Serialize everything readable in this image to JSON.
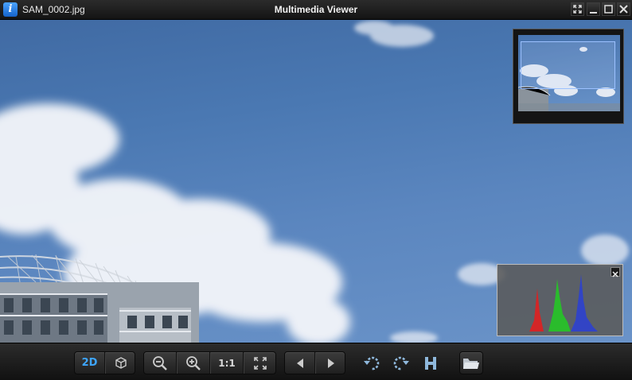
{
  "titlebar": {
    "file_name": "SAM_0002.jpg",
    "app_title": "Multimedia Viewer",
    "app_icon": "info-icon",
    "buttons": [
      "fullscreen-icon",
      "minimize-icon",
      "maximize-icon",
      "close-icon"
    ]
  },
  "viewport": {
    "image": "sky-clouds-stadium-photo",
    "navigator": {
      "visible": true
    },
    "histogram": {
      "visible": true,
      "channels": [
        "red",
        "green",
        "blue"
      ]
    }
  },
  "toolbar": {
    "view_2d_label": "2D",
    "view_3d_icon": "3d-view-icon",
    "zoom_out_icon": "zoom-out-icon",
    "zoom_in_icon": "zoom-in-icon",
    "actual_size_label": "1:1",
    "fit_icon": "fit-to-window-icon",
    "prev_icon": "previous-icon",
    "next_icon": "next-icon",
    "rotate_left_icon": "rotate-left-icon",
    "rotate_right_icon": "rotate-right-icon",
    "histogram_icon": "histogram-icon",
    "open_folder_icon": "folder-icon"
  },
  "colors": {
    "accent": "#3ea6ff",
    "toolbar_bg": "#1f1f1f",
    "sky": "#4a78b2"
  }
}
